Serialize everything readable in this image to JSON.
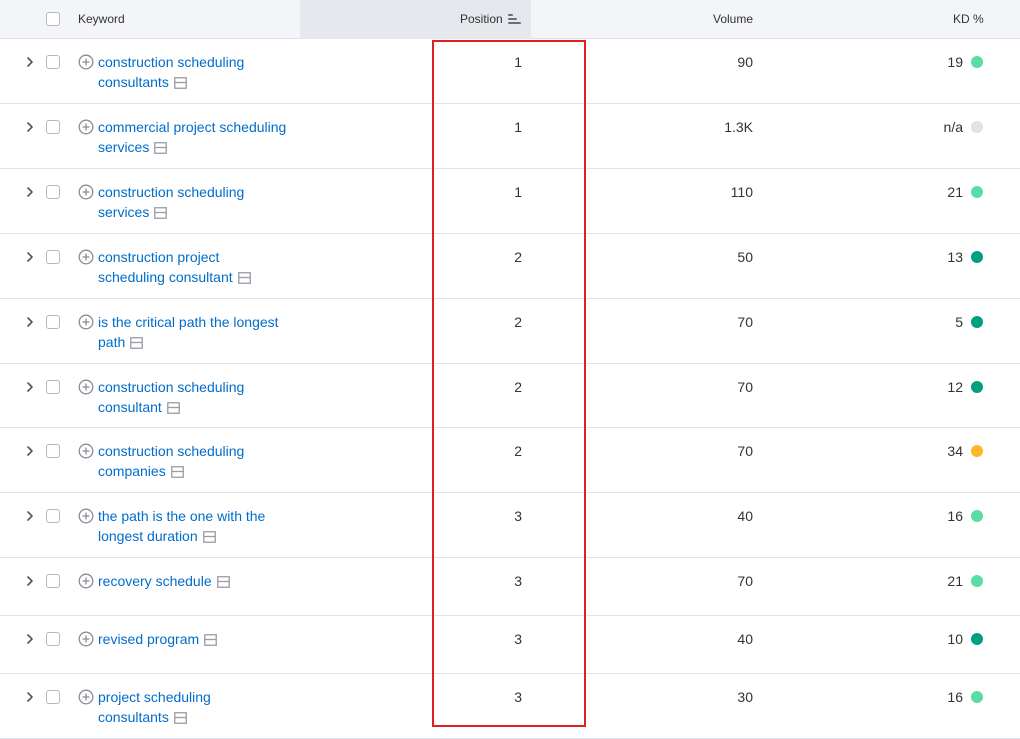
{
  "header": {
    "keyword_label": "Keyword",
    "position_label": "Position",
    "volume_label": "Volume",
    "kd_label": "KD %"
  },
  "colors": {
    "link": "#006dca",
    "kd_easy_light": "#59dda4",
    "kd_easy_dark": "#009f81",
    "kd_medium": "#fcb72b",
    "kd_na": "#e0e1e9",
    "highlight_border": "#e02020"
  },
  "icons": {
    "expand": "chevron-right-icon",
    "add": "plus-circle-icon",
    "serp": "serp-features-icon",
    "sort": "sort-descending-icon"
  },
  "rows": [
    {
      "keyword": "construction scheduling consultants",
      "kw1": "construction scheduling",
      "kw2": "consultants",
      "position": "1",
      "volume": "90",
      "kd": "19",
      "kd_color": "#59dda4"
    },
    {
      "keyword": "commercial project scheduling services",
      "kw1": "commercial project scheduling",
      "kw2": "services",
      "position": "1",
      "volume": "1.3K",
      "kd": "n/a",
      "kd_color": "#e0e1e9"
    },
    {
      "keyword": "construction scheduling services",
      "kw1": "construction scheduling",
      "kw2": "services",
      "position": "1",
      "volume": "110",
      "kd": "21",
      "kd_color": "#59dda4"
    },
    {
      "keyword": "construction project scheduling consultant",
      "kw1": "construction project",
      "kw2": "scheduling consultant",
      "position": "2",
      "volume": "50",
      "kd": "13",
      "kd_color": "#009f81"
    },
    {
      "keyword": "is the critical path the longest path",
      "kw1": "is the critical path the longest",
      "kw2": "path",
      "position": "2",
      "volume": "70",
      "kd": "5",
      "kd_color": "#009f81"
    },
    {
      "keyword": "construction scheduling consultant",
      "kw1": "construction scheduling",
      "kw2": "consultant",
      "position": "2",
      "volume": "70",
      "kd": "12",
      "kd_color": "#009f81"
    },
    {
      "keyword": "construction scheduling companies",
      "kw1": "construction scheduling",
      "kw2": "companies",
      "position": "2",
      "volume": "70",
      "kd": "34",
      "kd_color": "#fcb72b"
    },
    {
      "keyword": "the path is the one with the longest duration",
      "kw1": "the path is the one with the",
      "kw2": "longest duration",
      "position": "3",
      "volume": "40",
      "kd": "16",
      "kd_color": "#59dda4"
    },
    {
      "keyword": "recovery schedule",
      "kw1": "recovery schedule",
      "kw2": "",
      "position": "3",
      "volume": "70",
      "kd": "21",
      "kd_color": "#59dda4"
    },
    {
      "keyword": "revised program",
      "kw1": "revised program",
      "kw2": "",
      "position": "3",
      "volume": "40",
      "kd": "10",
      "kd_color": "#009f81"
    },
    {
      "keyword": "project scheduling consultants",
      "kw1": "project scheduling",
      "kw2": "consultants",
      "position": "3",
      "volume": "30",
      "kd": "16",
      "kd_color": "#59dda4"
    }
  ]
}
